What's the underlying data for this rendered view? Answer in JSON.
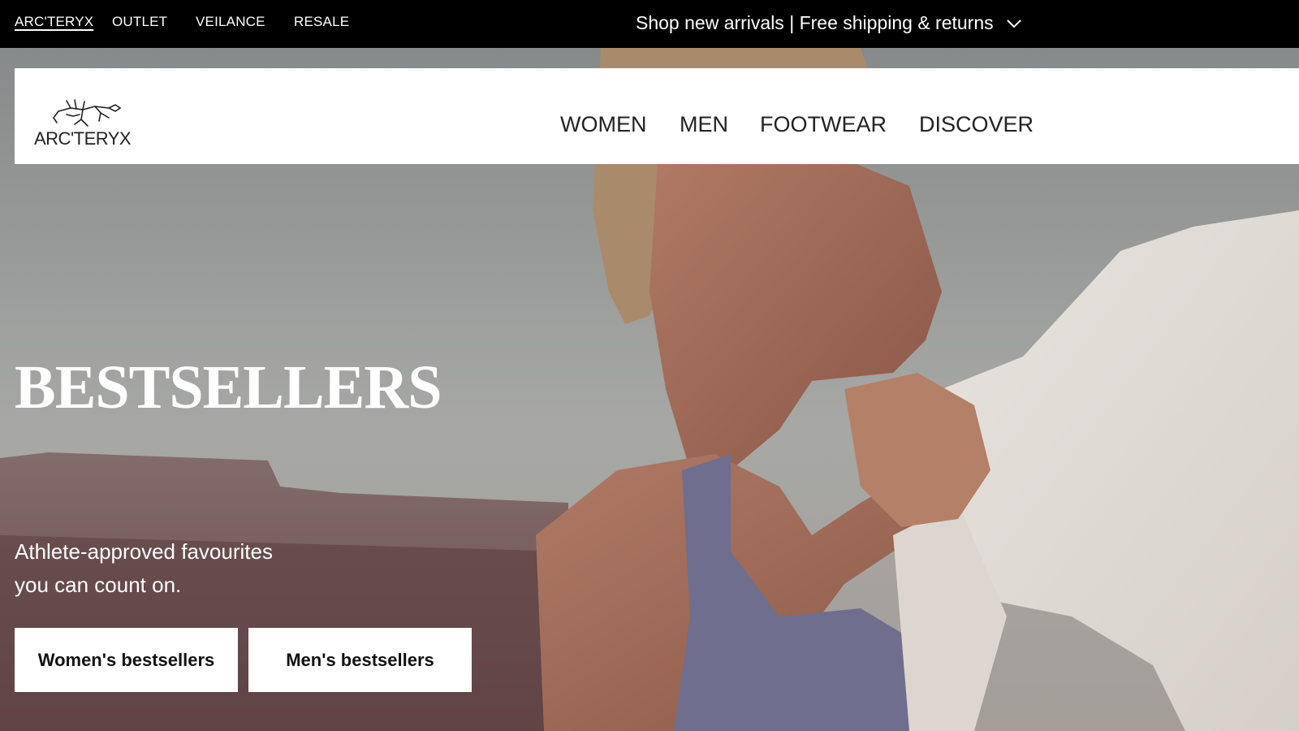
{
  "topbar": {
    "brands": [
      {
        "label": "ARC'TERYX",
        "active": true
      },
      {
        "label": "OUTLET",
        "active": false
      },
      {
        "label": "VEILANCE",
        "active": false
      },
      {
        "label": "RESALE",
        "active": false
      }
    ],
    "promo_text": "Shop new arrivals | Free shipping & returns",
    "promo_icon": "chevron-down-icon"
  },
  "nav": {
    "logo_text": "ARC'TERYX",
    "logo_icon": "archaeopteryx-logo-icon",
    "items": [
      {
        "label": "WOMEN"
      },
      {
        "label": "MEN"
      },
      {
        "label": "FOOTWEAR"
      },
      {
        "label": "DISCOVER"
      }
    ]
  },
  "hero": {
    "title": "BESTSELLERS",
    "subtitle_line1": "Athlete-approved favourites",
    "subtitle_line2": "you can count on.",
    "cta_women": "Women's bestsellers",
    "cta_men": "Men's bestsellers"
  },
  "colors": {
    "topbar_bg": "#000000",
    "nav_bg": "#ffffff",
    "text_dark": "#222222",
    "text_light": "#ffffff"
  }
}
